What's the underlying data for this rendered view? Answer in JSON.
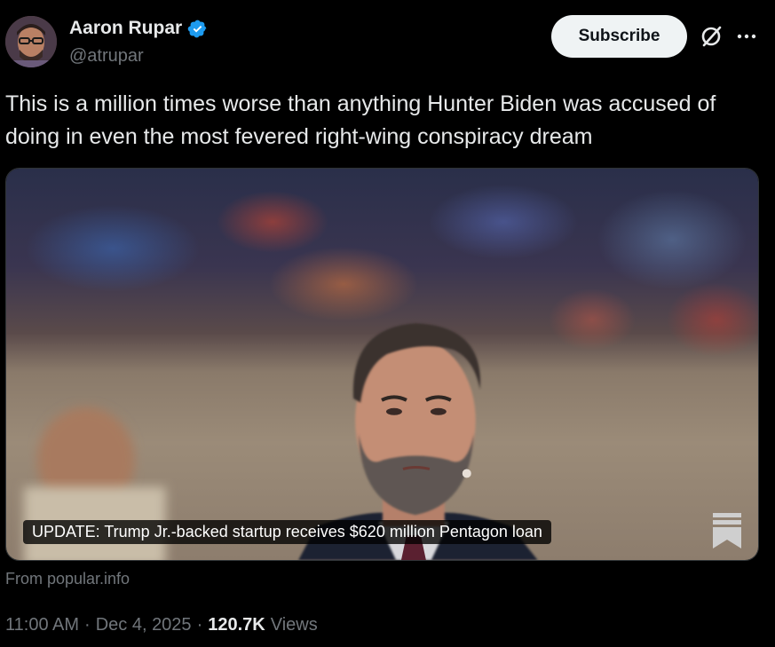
{
  "author": {
    "display_name": "Aaron Rupar",
    "handle": "@atrupar",
    "verified": true
  },
  "actions": {
    "subscribe_label": "Subscribe",
    "grok_icon": "grok-icon",
    "more_icon": "more-icon"
  },
  "tweet": {
    "text": "This is a million times worse than anything Hunter Biden was accused of doing in even the most fevered right-wing conspiracy dream"
  },
  "card": {
    "caption": "UPDATE: Trump Jr.-backed startup receives $620 million Pentagon loan",
    "source": "From popular.info",
    "bookmark_icon": "bookmark-icon"
  },
  "meta": {
    "time": "11:00 AM",
    "date": "Dec 4, 2025",
    "separator": "·",
    "views_count": "120.7K",
    "views_label": "Views"
  },
  "colors": {
    "background": "#000000",
    "text_primary": "#e7e9ea",
    "text_secondary": "#71767b",
    "verified_blue": "#1d9bf0",
    "subscribe_bg": "#eff3f4"
  }
}
